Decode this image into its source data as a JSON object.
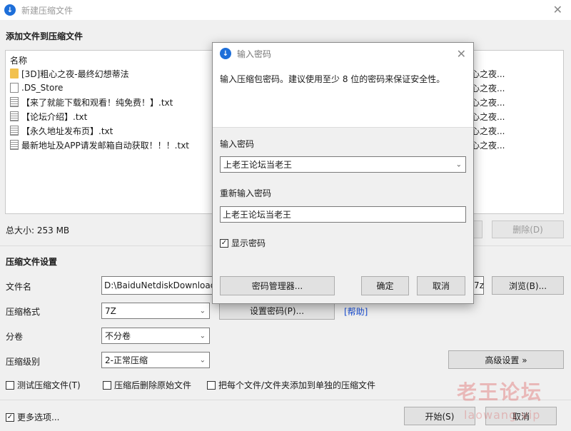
{
  "window": {
    "title": "新建压缩文件",
    "close": "✕"
  },
  "add_section": {
    "title": "添加文件到压缩文件"
  },
  "filelist": {
    "header": "名称",
    "rows": [
      {
        "icon": "folder-icon",
        "name": "[3D]粗心之夜-最终幻想蒂法",
        "right": "心之夜..."
      },
      {
        "icon": "file-icon",
        "name": ".DS_Store",
        "right": "心之夜..."
      },
      {
        "icon": "text-file-icon",
        "name": "【来了就能下载和观看！纯免费！】.txt",
        "right": "心之夜..."
      },
      {
        "icon": "text-file-icon",
        "name": "【论坛介绍】.txt",
        "right": "心之夜..."
      },
      {
        "icon": "text-file-icon",
        "name": "【永久地址发布页】.txt",
        "right": "心之夜..."
      },
      {
        "icon": "text-file-icon",
        "name": "最新地址及APP请发邮箱自动获取！！！.txt",
        "right": "心之夜..."
      }
    ]
  },
  "total_size": "总大小: 253 MB",
  "delete_button": "删除(D)",
  "settings": {
    "title": "压缩文件设置",
    "filename_label": "文件名",
    "filename_value": "D:\\BaiduNetdiskDownload",
    "filename_tail": "7z",
    "browse_button": "浏览(B)...",
    "format_label": "压缩格式",
    "format_value": "7Z",
    "set_password_button": "设置密码(P)...",
    "help_link": "[帮助]",
    "volume_label": "分卷",
    "volume_value": "不分卷",
    "level_label": "压缩级别",
    "level_value": "2-正常压缩",
    "advanced_button": "高级设置 »",
    "check_test": "测试压缩文件(T)",
    "check_delete": "压缩后删除原始文件",
    "check_each": "把每个文件/文件夹添加到单独的压缩文件"
  },
  "footer": {
    "more_options": "更多选项...",
    "start_button": "开始(S)",
    "cancel_button": "取消"
  },
  "dialog": {
    "title": "输入密码",
    "close": "✕",
    "description": "输入压缩包密码。建议使用至少 8 位的密码来保证安全性。",
    "password_label": "输入密码",
    "password_value": "上老王论坛当老王",
    "repeat_label": "重新输入密码",
    "repeat_value": "上老王论坛当老王",
    "show_password": "显示密码",
    "manager_button": "密码管理器...",
    "ok_button": "确定",
    "cancel_button": "取消"
  },
  "watermark": {
    "text": "老王论坛",
    "url": "laowang.vip"
  },
  "colors": {
    "accent": "#1e6fd9",
    "link": "#1a4fd6"
  }
}
